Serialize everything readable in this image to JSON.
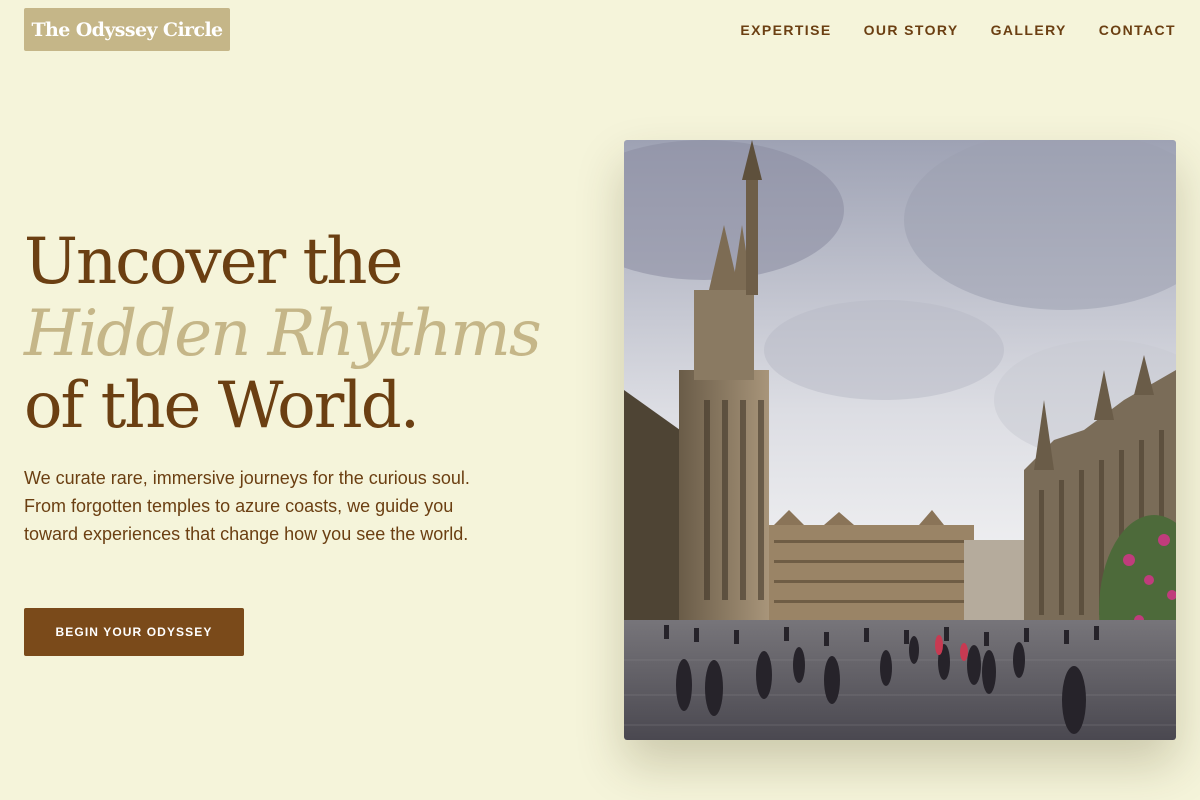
{
  "brand": {
    "name": "The Odyssey Circle"
  },
  "nav": {
    "items": [
      {
        "label": "EXPERTISE"
      },
      {
        "label": "OUR STORY"
      },
      {
        "label": "GALLERY"
      },
      {
        "label": "CONTACT"
      }
    ]
  },
  "hero": {
    "headline_line1": "Uncover the",
    "headline_accent": "Hidden Rhythms",
    "headline_line3": "of the World.",
    "description": "We curate rare, immersive journeys for the curious soul. From forgotten temples to azure coasts, we guide you toward experiences that change how you see the world.",
    "cta_label": "BEGIN YOUR ODYSSEY",
    "image": {
      "subject": "grand-square-gothic-town-hall-photo"
    }
  },
  "colors": {
    "background": "#f5f4da",
    "brand_brown": "#6b3f12",
    "accent_gold": "#c5b688",
    "button_brown": "#7a4a1a"
  }
}
